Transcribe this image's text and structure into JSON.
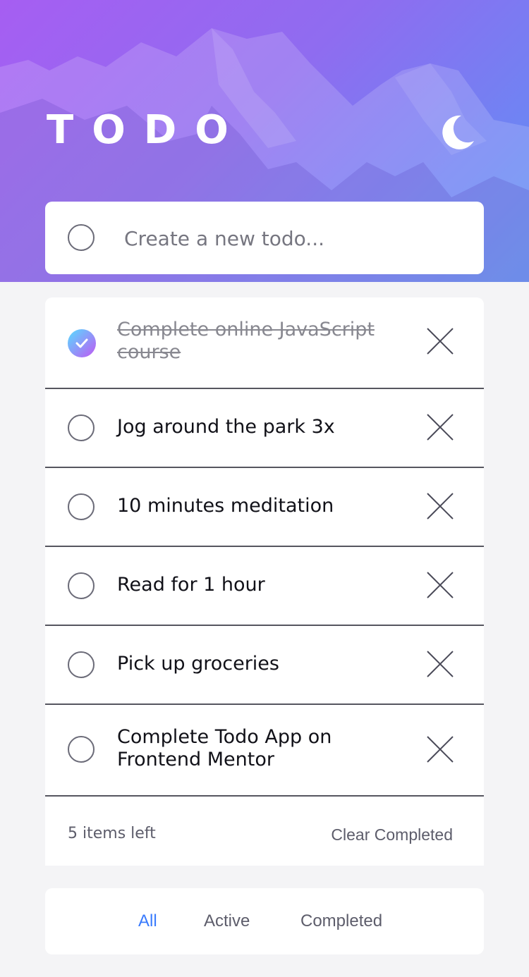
{
  "header": {
    "title": "TODO",
    "theme_icon": "moon-icon"
  },
  "new_todo": {
    "placeholder": "Create a new todo...",
    "value": ""
  },
  "todos": [
    {
      "text": "Complete online JavaScript course",
      "completed": true
    },
    {
      "text": "Jog around the park 3x",
      "completed": false
    },
    {
      "text": "10 minutes meditation",
      "completed": false
    },
    {
      "text": "Read for 1 hour",
      "completed": false
    },
    {
      "text": "Pick up groceries",
      "completed": false
    },
    {
      "text": "Complete Todo App on Frontend Mentor",
      "completed": false
    }
  ],
  "footer": {
    "items_left": "5 items left",
    "clear_label": "Clear Completed"
  },
  "filters": {
    "all": "All",
    "active": "Active",
    "completed": "Completed",
    "selected": "All"
  },
  "colors": {
    "accent": "#3a7bfd",
    "check_gradient_start": "#57ddff",
    "check_gradient_end": "#c058f3",
    "hero_start": "#a65ef2",
    "hero_end": "#5c92f5"
  }
}
